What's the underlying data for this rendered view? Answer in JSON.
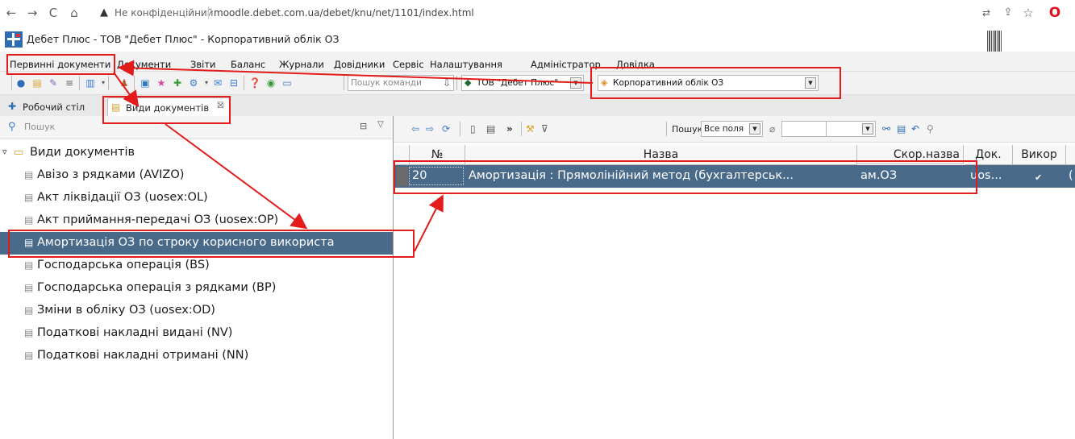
{
  "browser": {
    "back": "←",
    "forward": "→",
    "reload": "C",
    "home": "⌂",
    "security": "Не конфіденційний",
    "url": "moodle.debet.com.ua/debet/knu/net/1101/index.html"
  },
  "window": {
    "title": "Дебет Плюс - ТОВ \"Дебет Плюс\" - Корпоративний облік ОЗ"
  },
  "menu": {
    "items": [
      "Первинні документи",
      "Документи",
      "Звіти",
      "Баланс",
      "Журнали",
      "Довідники",
      "Сервіс",
      "Налаштування",
      "Адміністратор",
      "Довідка"
    ]
  },
  "toolbar": {
    "command_search_placeholder": "Пошук команди",
    "company_combo": "ТОВ \"Дебет Плюс\"",
    "config_combo": "Корпоративний облік ОЗ"
  },
  "tabs": [
    {
      "label": "Робочий стіл"
    },
    {
      "label": "Види документів"
    }
  ],
  "left": {
    "search_label": "Пошук",
    "tree_root": "Види документів",
    "tree_items": [
      "Авізо з рядками (AVIZO)",
      "Акт ліквідації ОЗ (uosex:OL)",
      "Акт приймання-передачі ОЗ (uosex:OP)",
      "Амортизація ОЗ по строку корисного використа",
      "Господарська операція (BS)",
      "Господарська операція з рядками (BP)",
      "Зміни в обліку ОЗ (uosex:OD)",
      "Податкові накладні видані (NV)",
      "Податкові накладні отримані (NN)"
    ],
    "selected_index": 3
  },
  "right": {
    "search_label": "Пошук:",
    "search_scope": "Все поля",
    "columns": [
      "№",
      "Назва",
      "Скор.назва",
      "Док.",
      "Викор"
    ],
    "rows": [
      {
        "num": "20",
        "name": "Амортизація : Прямолінійний метод  (бухгалтерськ...",
        "short": "ам.ОЗ",
        "doc": "uos...",
        "used": "✔",
        "extra": "("
      }
    ]
  },
  "colors": {
    "highlight": "#4a6a8a",
    "annotation": "#e31b1b"
  }
}
